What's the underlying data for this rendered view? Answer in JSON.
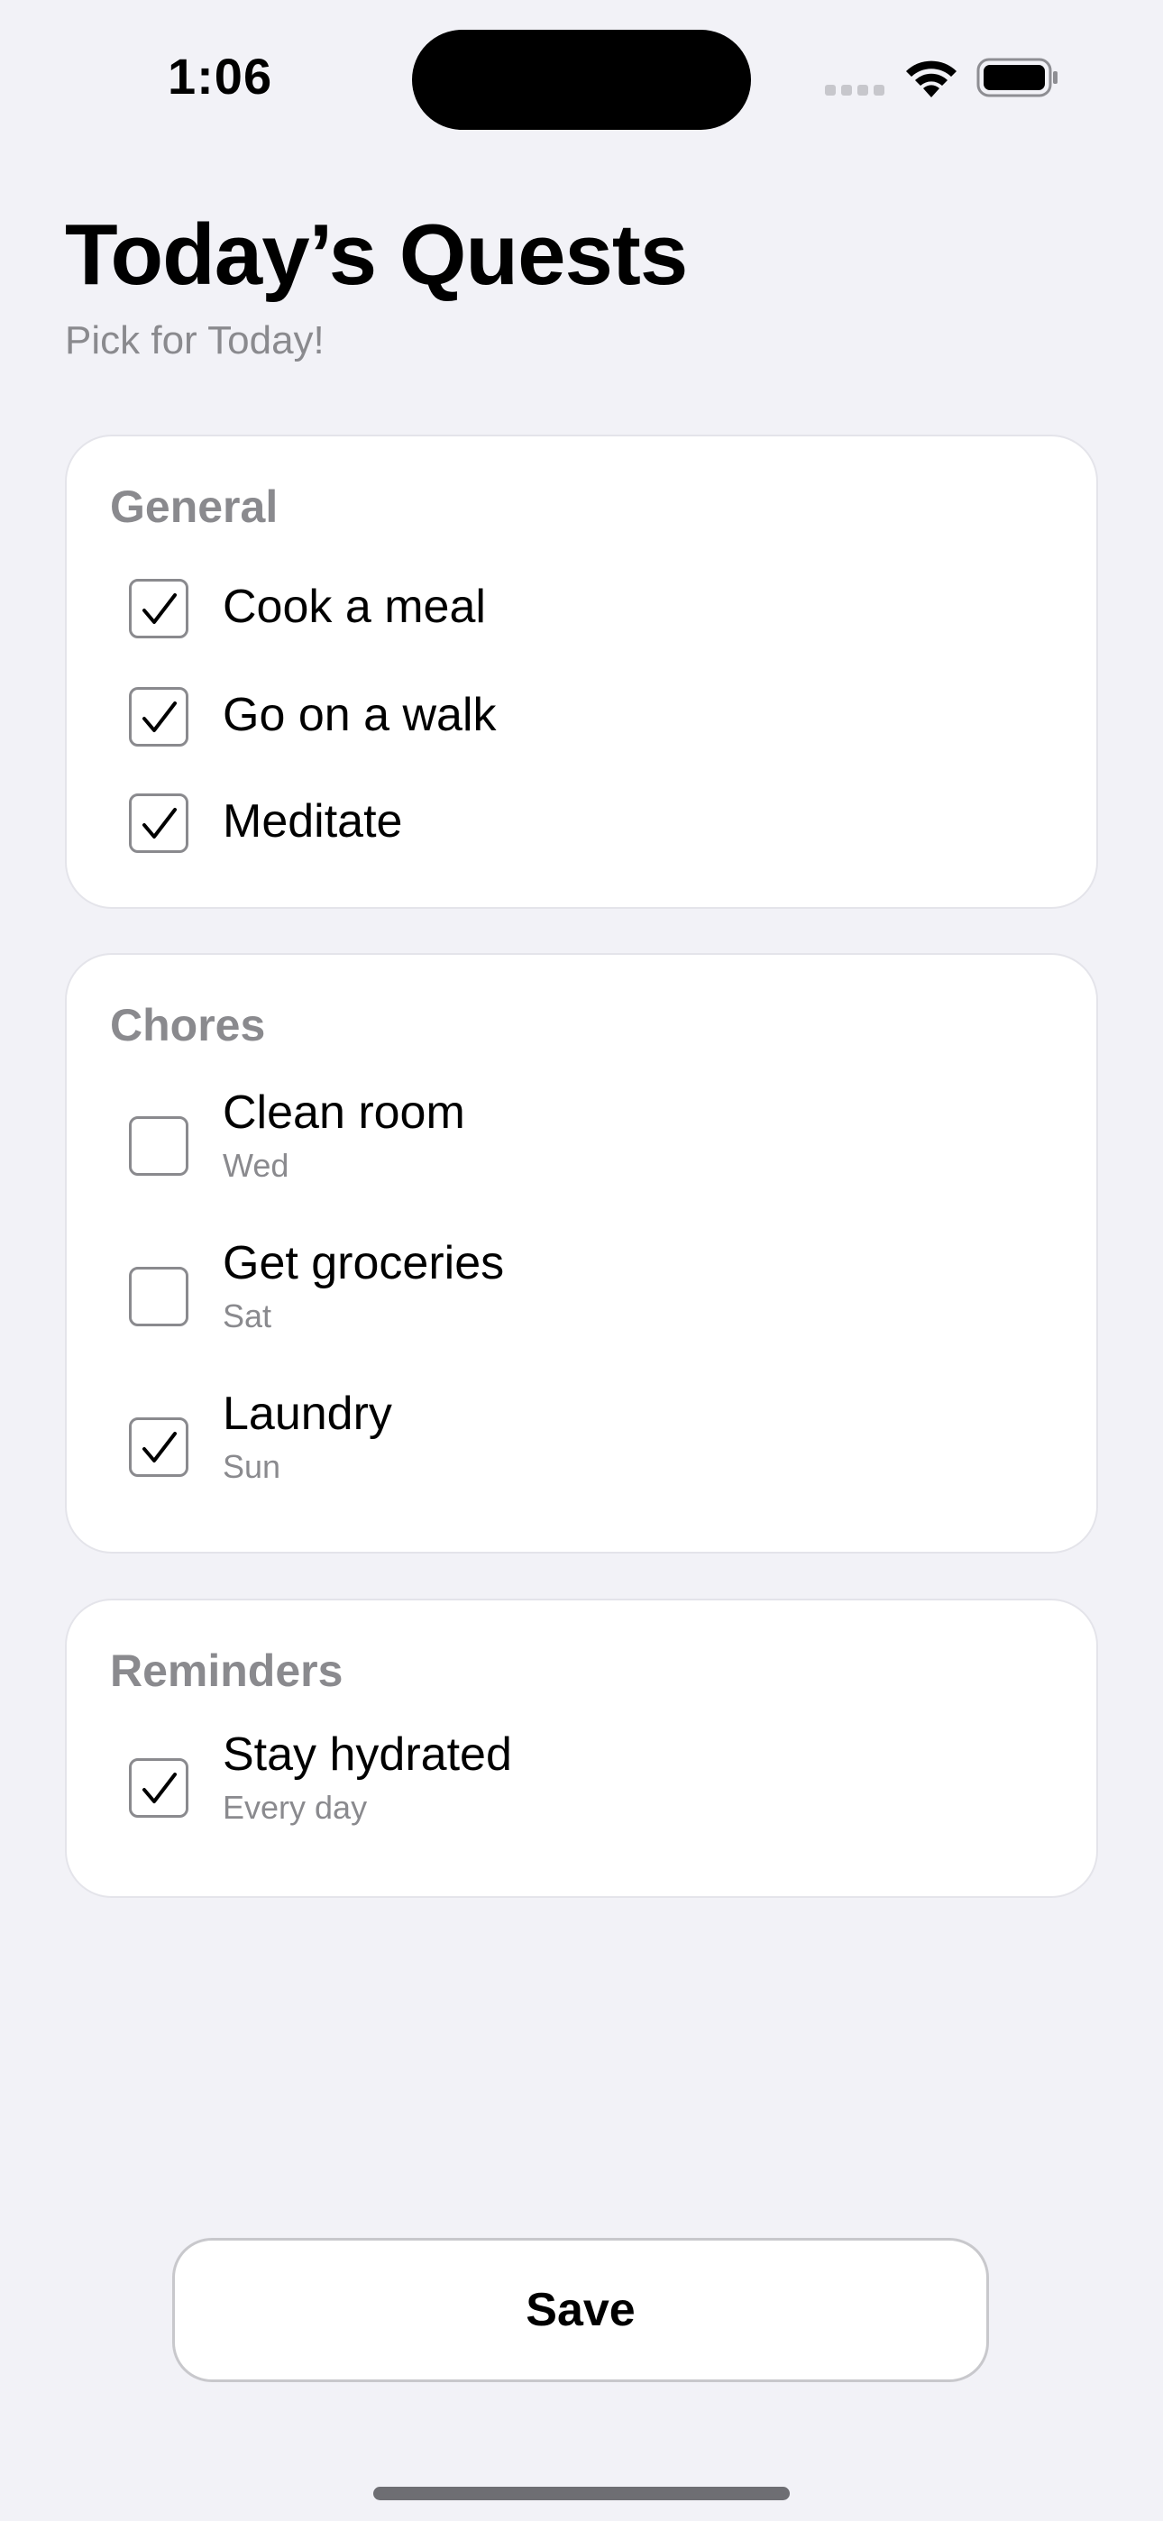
{
  "status_bar": {
    "time": "1:06",
    "icons": [
      "cellular-signal-icon",
      "wifi-icon",
      "battery-icon"
    ]
  },
  "header": {
    "title": "Today’s Quests",
    "subtitle": "Pick for Today!"
  },
  "sections": {
    "general": {
      "title": "General",
      "items": [
        {
          "label": "Cook a meal",
          "checked": true
        },
        {
          "label": "Go on a walk",
          "checked": true
        },
        {
          "label": "Meditate",
          "checked": true
        }
      ]
    },
    "chores": {
      "title": "Chores",
      "items": [
        {
          "label": "Clean room",
          "day": "Wed",
          "checked": false
        },
        {
          "label": "Get groceries",
          "day": "Sat",
          "checked": false
        },
        {
          "label": "Laundry",
          "day": "Sun",
          "checked": true
        }
      ]
    },
    "reminders": {
      "title": "Reminders",
      "items": [
        {
          "label": "Stay hydrated",
          "day": "Every day",
          "checked": true
        }
      ]
    }
  },
  "save_button": {
    "label": "Save"
  },
  "colors": {
    "background": "#f2f2f7",
    "card": "#ffffff",
    "secondary_text": "#8a8a8e",
    "checkbox_border": "#8a8a8e"
  }
}
